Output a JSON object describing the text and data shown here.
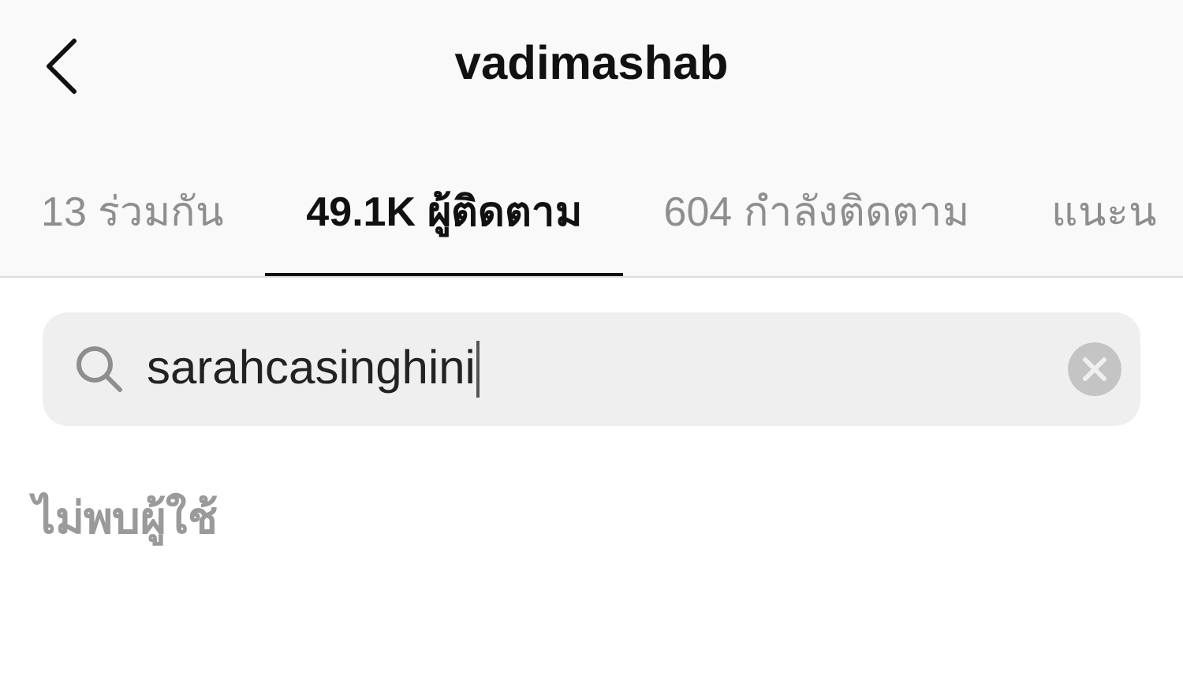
{
  "header": {
    "title": "vadimashab"
  },
  "tabs": [
    {
      "label": "13 ร่วมกัน",
      "selected": false
    },
    {
      "label": "49.1K ผู้ติดตาม",
      "selected": true
    },
    {
      "label": "604 กำลังติดตาม",
      "selected": false
    },
    {
      "label": "แนะน",
      "selected": false
    }
  ],
  "search": {
    "value": "sarahcasinghini",
    "focused": true
  },
  "message": "ไม่พบผู้ใช้"
}
